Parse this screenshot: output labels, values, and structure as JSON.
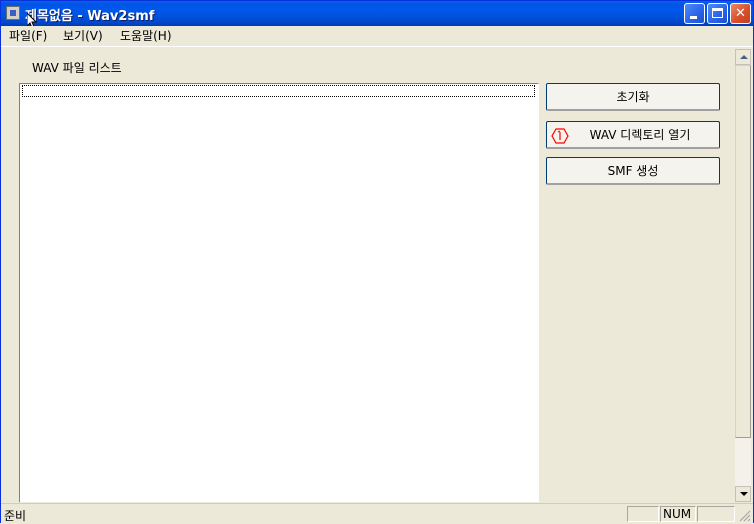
{
  "window": {
    "title": "제목없음 - Wav2smf",
    "icon": "app-icon",
    "controls": [
      "minimize-icon",
      "maximize-icon",
      "close-icon"
    ]
  },
  "menu": {
    "items": [
      {
        "label": "파일(F)"
      },
      {
        "label": "보기(V)"
      },
      {
        "label": "도움말(H)"
      }
    ]
  },
  "main": {
    "list_label": "WAV 파일 리스트",
    "buttons": {
      "reset": "초기화",
      "open_dir": "WAV 디렉토리 열기",
      "create_smf": "SMF 생성"
    },
    "annotation_icon": "red-hexagon-marker"
  },
  "status": {
    "text": "준비",
    "num": "NUM"
  },
  "colors": {
    "titlebar": "#0054e3",
    "face": "#ece9d8",
    "annotation": "#ff0000"
  }
}
